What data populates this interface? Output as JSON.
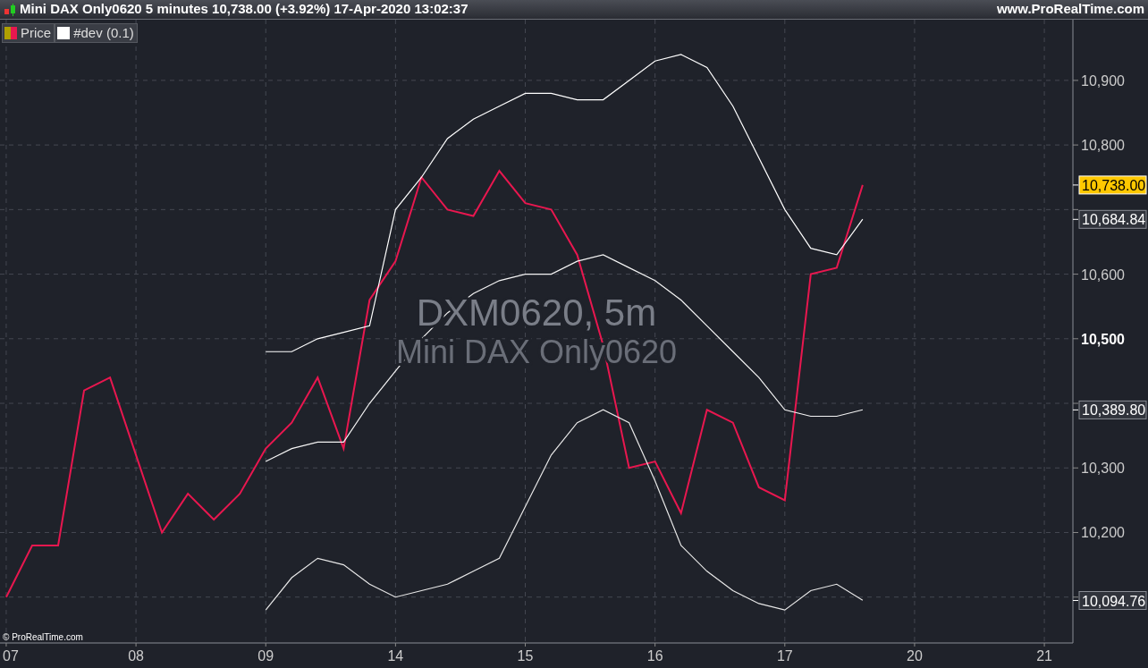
{
  "header": {
    "title": "Mini DAX Only0620 5 minutes 10,738.00 (+3.92%) 17-Apr-2020 13:02:37",
    "site": "www.ProRealTime.com"
  },
  "chart": {
    "symbol_label": "DXM0620, 5m",
    "name_label": "Mini DAX Only0620",
    "copyright": "© ProRealTime.com",
    "price_tags": [
      {
        "kind": "last"
      },
      {
        "kind": "indicator"
      },
      {
        "kind": "indicator"
      },
      {
        "kind": "indicator"
      }
    ],
    "chart_data": {
      "type": "line",
      "categories": [
        "07",
        null,
        null,
        null,
        null,
        "08",
        null,
        null,
        null,
        null,
        "09",
        null,
        null,
        null,
        null,
        "14",
        null,
        null,
        null,
        null,
        "15",
        null,
        null,
        null,
        null,
        "16",
        null,
        null,
        null,
        null,
        "17",
        null,
        null,
        null,
        null,
        "20",
        null,
        null,
        null,
        null,
        "21"
      ],
      "series": [
        {
          "name": "Price",
          "color": "#e8174f",
          "values": [
            10100,
            10180,
            10180,
            10420,
            10440,
            10320,
            10200,
            10260,
            10220,
            10260,
            10330,
            10370,
            10440,
            10330,
            10560,
            10620,
            10750,
            10700,
            10690,
            10760,
            10710,
            10700,
            10630,
            10490,
            10300,
            10310,
            10230,
            10390,
            10370,
            10270,
            10250,
            10600,
            10610,
            10738,
            null,
            null,
            null,
            null,
            null,
            null,
            null
          ]
        },
        {
          "name": "#dev (0.1)",
          "color": "#ffffff",
          "values": [
            null,
            null,
            null,
            null,
            null,
            null,
            null,
            null,
            null,
            null,
            10480,
            10480,
            10500,
            10510,
            10520,
            10700,
            10750,
            10810,
            10840,
            10860,
            10880,
            10880,
            10870,
            10870,
            10900,
            10930,
            10940,
            10920,
            10860,
            10780,
            10700,
            10640,
            10630,
            10685,
            null,
            null,
            null,
            null,
            null,
            null,
            null
          ]
        },
        {
          "color": "#f4f4f4",
          "values": [
            null,
            null,
            null,
            null,
            null,
            null,
            null,
            null,
            null,
            null,
            10310,
            10330,
            10340,
            10340,
            10400,
            10450,
            10500,
            10540,
            10570,
            10590,
            10600,
            10600,
            10620,
            10630,
            10610,
            10590,
            10560,
            10520,
            10480,
            10440,
            10390,
            10380,
            10380,
            10390,
            null,
            null,
            null,
            null,
            null,
            null,
            null
          ]
        },
        {
          "color": "#e8e8e8",
          "values": [
            null,
            null,
            null,
            null,
            null,
            null,
            null,
            null,
            null,
            null,
            10080,
            10130,
            10160,
            10150,
            10120,
            10100,
            10110,
            10120,
            10140,
            10160,
            10240,
            10320,
            10370,
            10390,
            10370,
            10280,
            10180,
            10140,
            10110,
            10090,
            10080,
            10110,
            10120,
            10095,
            null,
            null,
            null,
            null,
            null,
            null,
            null
          ]
        }
      ],
      "ylim": [
        10029,
        10994
      ],
      "yticks": [
        {
          "value": 10200,
          "label": "10,200"
        },
        {
          "value": 10300,
          "label": "10,300"
        },
        {
          "value": 10500,
          "label": "10,500"
        },
        {
          "value": 10600,
          "label": "10,600"
        },
        {
          "value": 10800,
          "label": "10,800"
        },
        {
          "value": 10900,
          "label": "10,900"
        }
      ],
      "grid": true,
      "annotations": [
        "10,738.00",
        "10,684.84",
        "10,389.80",
        "10,094.76"
      ]
    }
  }
}
